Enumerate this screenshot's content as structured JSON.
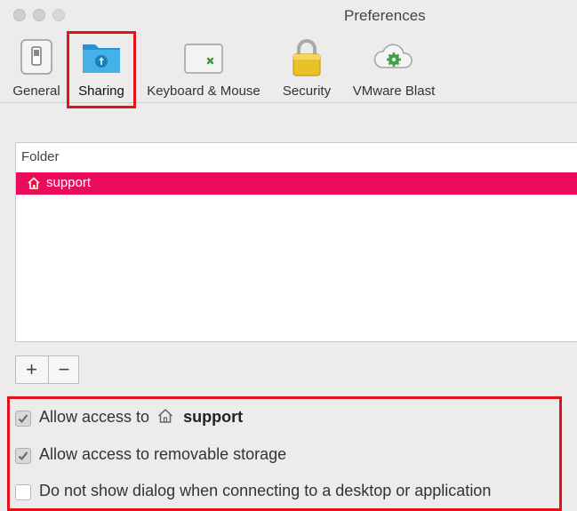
{
  "window": {
    "title": "Preferences"
  },
  "toolbar": {
    "tabs": [
      {
        "label": "General",
        "icon": "switch-icon"
      },
      {
        "label": "Sharing",
        "icon": "shared-folder-icon",
        "selected": true
      },
      {
        "label": "Keyboard & Mouse",
        "icon": "keyboard-icon"
      },
      {
        "label": "Security",
        "icon": "lock-icon"
      },
      {
        "label": "VMware Blast",
        "icon": "cloud-gear-icon"
      }
    ]
  },
  "folder_list": {
    "header": "Folder",
    "rows": [
      {
        "name": "support",
        "icon": "home-icon",
        "selected": true
      }
    ]
  },
  "list_buttons": {
    "add": "+",
    "remove": "−"
  },
  "options": [
    {
      "label": "Allow access to",
      "target": "support",
      "checked": true
    },
    {
      "label": "Allow access to removable storage",
      "checked": true
    },
    {
      "label": "Do not show dialog when connecting to a desktop or application",
      "checked": false
    }
  ],
  "colors": {
    "selection": "#ec0b5a",
    "highlight": "#e5121b",
    "folder": "#3fa9e0"
  }
}
